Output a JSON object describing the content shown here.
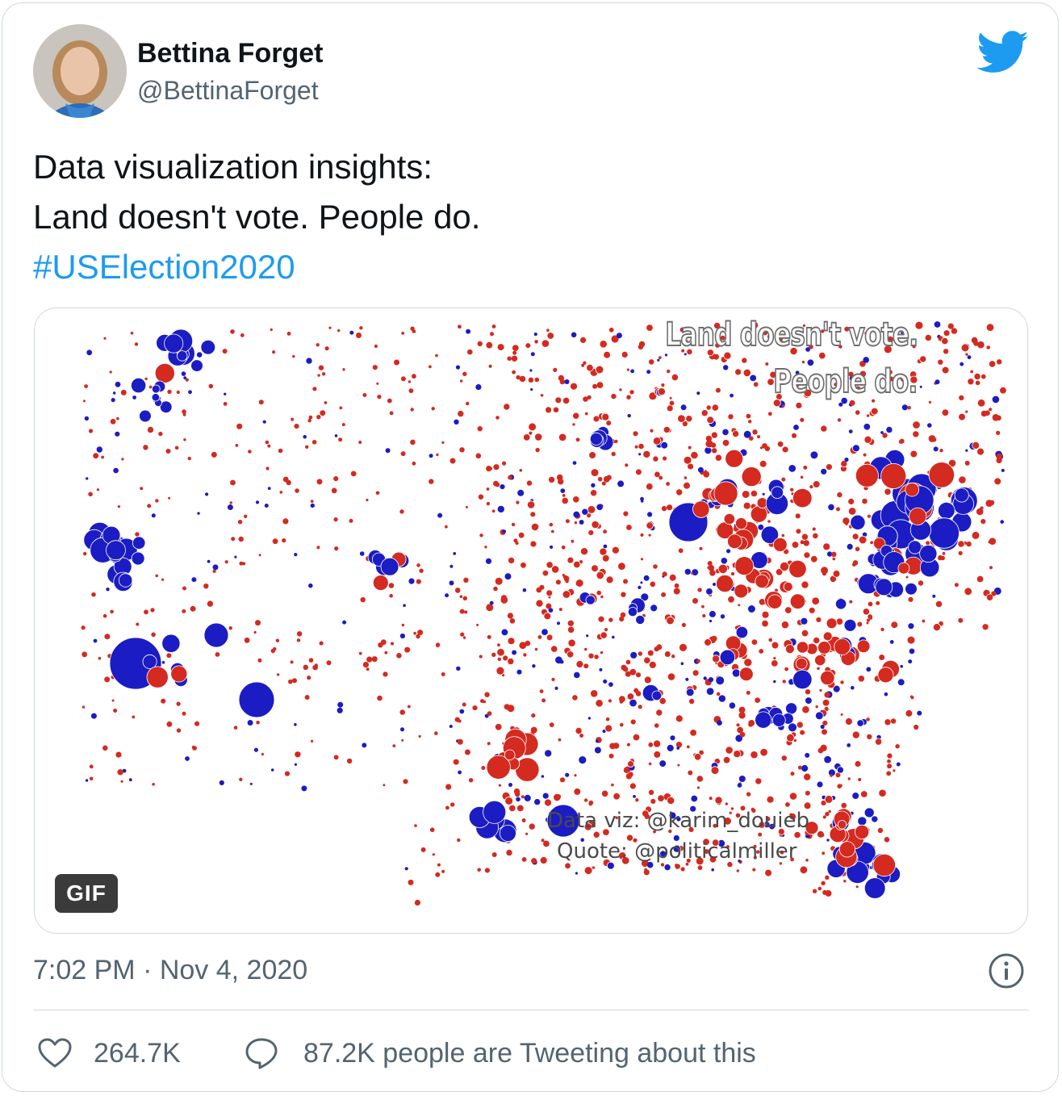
{
  "author": {
    "name": "Bettina Forget",
    "handle": "@BettinaForget"
  },
  "tweet": {
    "line1": "Data visualization insights:",
    "line2": "Land doesn't vote. People do.",
    "hashtag": "#USElection2020"
  },
  "media": {
    "type": "GIF",
    "badge": "GIF",
    "quote_line1": "Land doesn't vote.",
    "quote_line2": "People do.",
    "credit_viz": "Data viz: @karim_douieb",
    "credit_quote": "Quote: @politicalmiller",
    "colors": {
      "democrat": "#1c1cc4",
      "republican": "#d42a20"
    }
  },
  "timestamp": "7:02 PM · Nov 4, 2020",
  "actions": {
    "likes": "264.7K",
    "conversation": "87.2K people are Tweeting about this"
  },
  "brand": {
    "twitter_blue": "#1d9bf0"
  }
}
